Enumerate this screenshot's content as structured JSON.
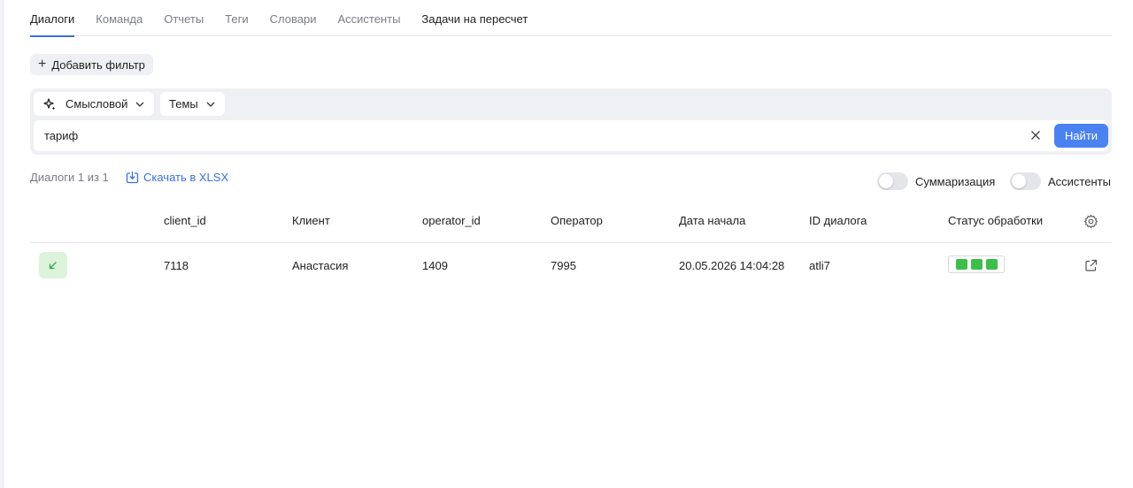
{
  "tabs": [
    {
      "label": "Диалоги",
      "active": true
    },
    {
      "label": "Команда"
    },
    {
      "label": "Отчеты"
    },
    {
      "label": "Теги"
    },
    {
      "label": "Словари"
    },
    {
      "label": "Ассистенты"
    },
    {
      "label": "Задачи на пересчет"
    }
  ],
  "filter": {
    "add_label": "Добавить фильтр"
  },
  "search": {
    "mode_label": "Смысловой",
    "themes_label": "Темы",
    "query": "тариф",
    "submit_label": "Найти",
    "icons": {
      "mode": "sparkle-icon",
      "dropdown": "chevron-down-icon",
      "clear": "close-icon"
    }
  },
  "results": {
    "count_label": "Диалоги 1 из 1",
    "download_label": "Скачать в XLSX",
    "toggles": {
      "summarization": "Суммаризация",
      "assistants": "Ассистенты"
    }
  },
  "table": {
    "columns": [
      "client_id",
      "Клиент",
      "operator_id",
      "Оператор",
      "Дата начала",
      "ID диалога",
      "Статус обработки"
    ],
    "rows": [
      {
        "direction_icon": "incoming-arrow-icon",
        "cells": [
          "7118",
          "Анастасия",
          "1409",
          "7995",
          "20.05.2026 14:04:28",
          "atli7"
        ],
        "status_segments": 3
      }
    ]
  },
  "colors": {
    "accent": "#4b82f1",
    "link": "#3b6fe0",
    "status_green": "#3bbf4a",
    "incoming_bg": "#dcf3dc",
    "incoming_icon": "#3aa54a"
  }
}
